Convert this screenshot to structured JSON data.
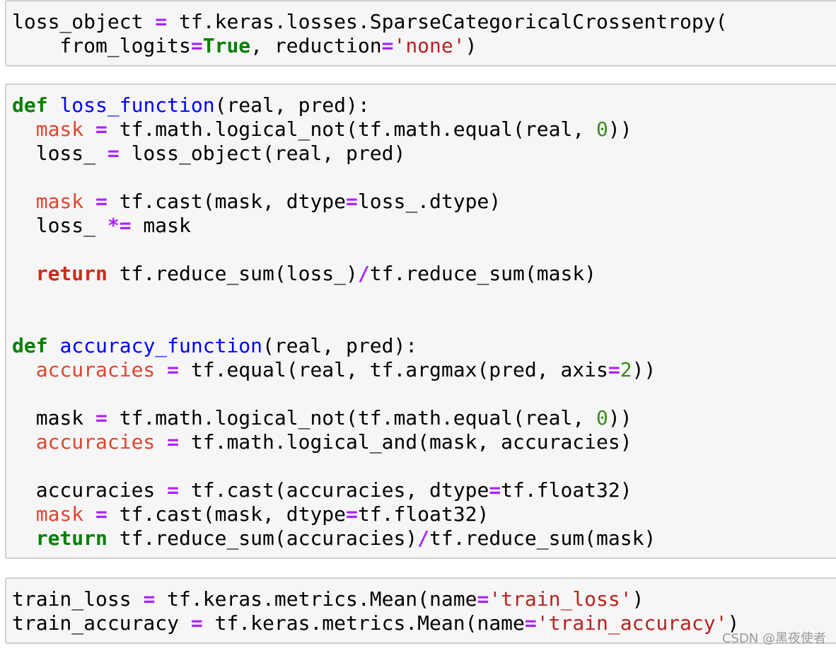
{
  "watermark": "CSDN @黑夜使者",
  "cells": [
    {
      "lines": [
        [
          {
            "t": "loss_object "
          },
          {
            "t": "=",
            "c": "op"
          },
          {
            "t": " tf.keras.losses.SparseCategoricalCrossentropy("
          }
        ],
        [
          {
            "t": "    from_logits"
          },
          {
            "t": "=",
            "c": "op"
          },
          {
            "t": "True",
            "c": "k"
          },
          {
            "t": ", reduction"
          },
          {
            "t": "=",
            "c": "op"
          },
          {
            "t": "'none'",
            "c": "s"
          },
          {
            "t": ")"
          }
        ]
      ]
    },
    {
      "lines": [
        [
          {
            "t": "def",
            "c": "k"
          },
          {
            "t": " "
          },
          {
            "t": "loss_function",
            "c": "fn"
          },
          {
            "t": "(real, pred):"
          }
        ],
        [
          {
            "t": "  "
          },
          {
            "t": "mask",
            "c": "rv"
          },
          {
            "t": " "
          },
          {
            "t": "=",
            "c": "op"
          },
          {
            "t": " tf.math.logical_not(tf.math.equal(real, "
          },
          {
            "t": "0",
            "c": "n"
          },
          {
            "t": "))"
          }
        ],
        [
          {
            "t": "  loss_ "
          },
          {
            "t": "=",
            "c": "op"
          },
          {
            "t": " loss_object(real, pred)"
          }
        ],
        [],
        [
          {
            "t": "  "
          },
          {
            "t": "mask",
            "c": "rv"
          },
          {
            "t": " "
          },
          {
            "t": "=",
            "c": "op"
          },
          {
            "t": " tf.cast(mask, dtype"
          },
          {
            "t": "=",
            "c": "op"
          },
          {
            "t": "loss_.dtype)"
          }
        ],
        [
          {
            "t": "  loss_ "
          },
          {
            "t": "*=",
            "c": "op"
          },
          {
            "t": " mask"
          }
        ],
        [],
        [
          {
            "t": "  "
          },
          {
            "t": "return",
            "c": "kr"
          },
          {
            "t": " tf.reduce_sum(loss_)"
          },
          {
            "t": "/",
            "c": "op"
          },
          {
            "t": "tf.reduce_sum(mask)"
          }
        ],
        [],
        [],
        [
          {
            "t": "def",
            "c": "k"
          },
          {
            "t": " "
          },
          {
            "t": "accuracy_function",
            "c": "fn"
          },
          {
            "t": "(real, pred):"
          }
        ],
        [
          {
            "t": "  "
          },
          {
            "t": "accuracies",
            "c": "rv"
          },
          {
            "t": " "
          },
          {
            "t": "=",
            "c": "op"
          },
          {
            "t": " tf.equal(real, tf.argmax(pred, axis"
          },
          {
            "t": "=",
            "c": "op"
          },
          {
            "t": "2",
            "c": "n"
          },
          {
            "t": "))"
          }
        ],
        [],
        [
          {
            "t": "  mask "
          },
          {
            "t": "=",
            "c": "op"
          },
          {
            "t": " tf.math.logical_not(tf.math.equal(real, "
          },
          {
            "t": "0",
            "c": "n"
          },
          {
            "t": "))"
          }
        ],
        [
          {
            "t": "  "
          },
          {
            "t": "accuracies",
            "c": "rv"
          },
          {
            "t": " "
          },
          {
            "t": "=",
            "c": "op"
          },
          {
            "t": " tf.math.logical_and(mask, accuracies)"
          }
        ],
        [],
        [
          {
            "t": "  accuracies "
          },
          {
            "t": "=",
            "c": "op"
          },
          {
            "t": " tf.cast(accuracies, dtype"
          },
          {
            "t": "=",
            "c": "op"
          },
          {
            "t": "tf.float32)"
          }
        ],
        [
          {
            "t": "  "
          },
          {
            "t": "mask",
            "c": "rv"
          },
          {
            "t": " "
          },
          {
            "t": "=",
            "c": "op"
          },
          {
            "t": " tf.cast(mask, dtype"
          },
          {
            "t": "=",
            "c": "op"
          },
          {
            "t": "tf.float32)"
          }
        ],
        [
          {
            "t": "  "
          },
          {
            "t": "return",
            "c": "kg"
          },
          {
            "t": " tf.reduce_sum(accuracies)"
          },
          {
            "t": "/",
            "c": "op"
          },
          {
            "t": "tf.reduce_sum(mask)"
          }
        ]
      ]
    },
    {
      "lines": [
        [
          {
            "t": "train_loss "
          },
          {
            "t": "=",
            "c": "op"
          },
          {
            "t": " tf.keras.metrics.Mean(name"
          },
          {
            "t": "=",
            "c": "op"
          },
          {
            "t": "'train_loss'",
            "c": "s"
          },
          {
            "t": ")"
          }
        ],
        [
          {
            "t": "train_accuracy "
          },
          {
            "t": "=",
            "c": "op"
          },
          {
            "t": " tf.keras.metrics.Mean(name"
          },
          {
            "t": "=",
            "c": "op"
          },
          {
            "t": "'train_accuracy'",
            "c": "s"
          },
          {
            "t": ")"
          }
        ]
      ]
    }
  ]
}
